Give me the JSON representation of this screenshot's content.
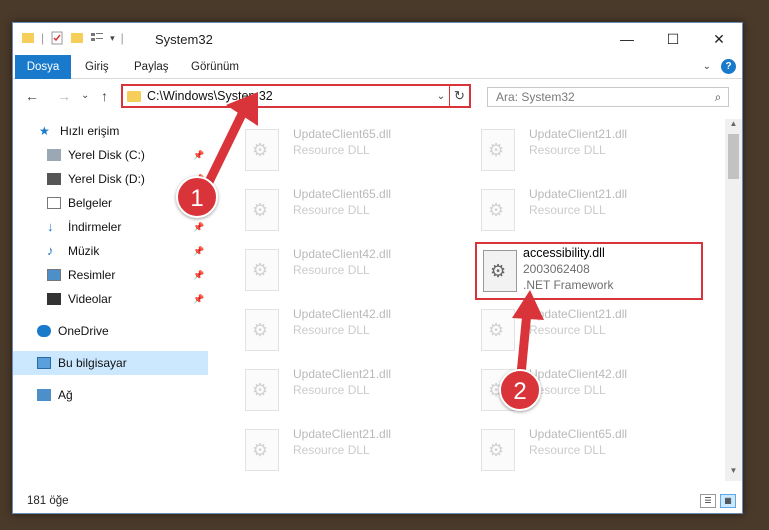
{
  "window": {
    "title": "System32"
  },
  "ribbon": {
    "tabs": [
      "Dosya",
      "Giriş",
      "Paylaş",
      "Görünüm"
    ]
  },
  "nav": {
    "back": "←",
    "forward": "→",
    "recent": "⌄",
    "up": "↑"
  },
  "address": {
    "path": "C:\\Windows\\System32"
  },
  "search": {
    "placeholder": "Ara: System32"
  },
  "sidebar": {
    "items": [
      {
        "label": "Hızlı erişim",
        "icon": "star-icon",
        "pinned": false
      },
      {
        "label": "Yerel Disk (C:)",
        "icon": "drive-icon",
        "pinned": true
      },
      {
        "label": "Yerel Disk (D:)",
        "icon": "drive-icon",
        "pinned": true
      },
      {
        "label": "Belgeler",
        "icon": "documents-icon",
        "pinned": true
      },
      {
        "label": "İndirmeler",
        "icon": "download-icon",
        "pinned": true
      },
      {
        "label": "Müzik",
        "icon": "music-icon",
        "pinned": true
      },
      {
        "label": "Resimler",
        "icon": "pictures-icon",
        "pinned": true
      },
      {
        "label": "Videolar",
        "icon": "videos-icon",
        "pinned": true
      },
      {
        "label": "OneDrive",
        "icon": "cloud-icon",
        "pinned": false
      },
      {
        "label": "Bu bilgisayar",
        "icon": "computer-icon",
        "pinned": false,
        "selected": true
      },
      {
        "label": "Ağ",
        "icon": "network-icon",
        "pinned": false
      }
    ]
  },
  "files": [
    {
      "name": "UpdateClient65.dll",
      "desc": "Resource DLL"
    },
    {
      "name": "UpdateClient21.dll",
      "desc": "Resource DLL"
    },
    {
      "name": "UpdateClient65.dll",
      "desc": "Resource DLL"
    },
    {
      "name": "UpdateClient21.dll",
      "desc": "Resource DLL"
    },
    {
      "name": "UpdateClient42.dll",
      "desc": "Resource DLL"
    },
    {
      "name": "accessibility.dll",
      "desc": "2003062408",
      "desc2": ".NET Framework",
      "highlight": true
    },
    {
      "name": "UpdateClient42.dll",
      "desc": "Resource DLL"
    },
    {
      "name": "UpdateClient21.dll",
      "desc": "Resource DLL"
    },
    {
      "name": "UpdateClient21.dll",
      "desc": "Resource DLL"
    },
    {
      "name": "UpdateClient42.dll",
      "desc": "Resource DLL"
    },
    {
      "name": "UpdateClient21.dll",
      "desc": "Resource DLL"
    },
    {
      "name": "UpdateClient65.dll",
      "desc": "Resource DLL"
    }
  ],
  "status": {
    "count": "181 öğe"
  },
  "annotations": {
    "step1": "1",
    "step2": "2",
    "color": "#d9343a"
  }
}
